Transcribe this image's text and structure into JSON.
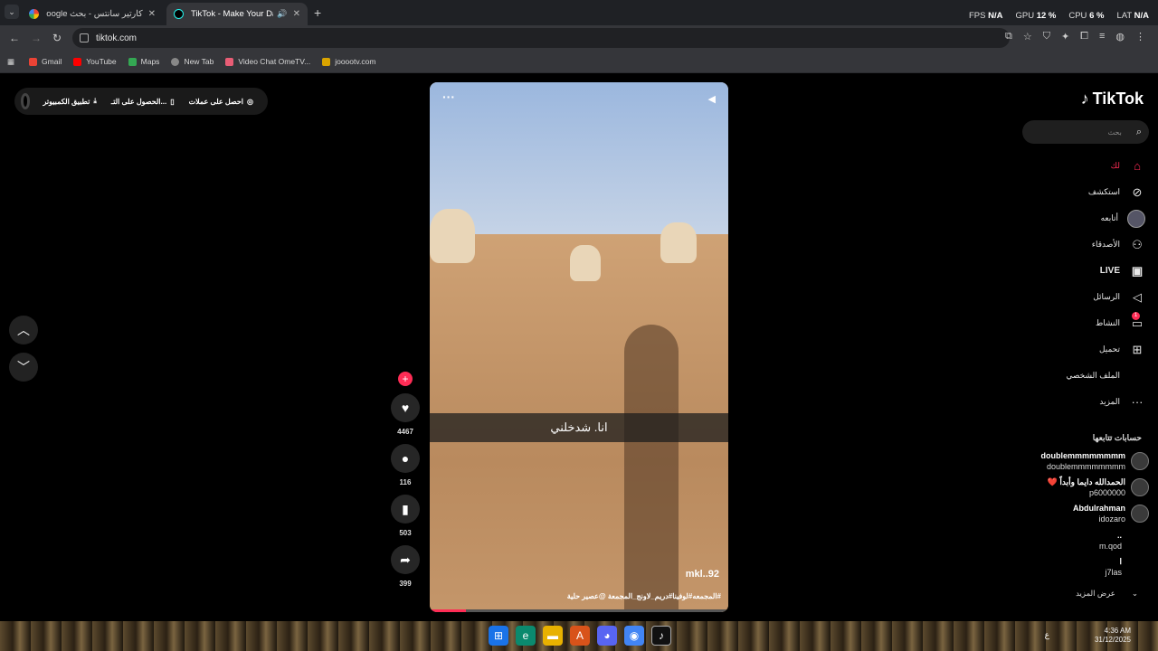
{
  "browser": {
    "tabs": [
      {
        "title": "كارتير سانتس - بحث Google",
        "active": false
      },
      {
        "title": "TikTok - Make Your Day",
        "active": true
      }
    ],
    "perf": {
      "fps_label": "FPS",
      "fps": "N/A",
      "gpu_label": "GPU",
      "gpu": "12 %",
      "cpu_label": "CPU",
      "cpu": "6 %",
      "lat_label": "LAT",
      "lat": "N/A"
    },
    "url": "tiktok.com",
    "bookmarks": [
      "Gmail",
      "YouTube",
      "Maps",
      "New Tab",
      "Video Chat OmeTV...",
      "jooootv.com"
    ]
  },
  "promo": {
    "item1": "احصل على عملات",
    "item2": "الحصول على التـ...",
    "item3": "تطبيق الكمبيوتر"
  },
  "video": {
    "caption": "انا. شدخلني",
    "author": "mkl..92",
    "description": "#المجمعه#لوفينا#دريم_لاونج_المجمعة @عصير حلية",
    "progress": 0.12
  },
  "actions": {
    "likes": "4467",
    "comments": "116",
    "saves": "503",
    "shares": "399"
  },
  "sidebar": {
    "logo": "TikTok",
    "search_placeholder": "بحث",
    "nav": [
      {
        "label": "لك",
        "icon": "home-icon"
      },
      {
        "label": "استكشف",
        "icon": "compass-icon"
      },
      {
        "label": "أتابعه",
        "icon": "avatar-icon"
      },
      {
        "label": "الأصدقاء",
        "icon": "friends-icon"
      },
      {
        "label": "LIVE",
        "icon": "live-icon"
      },
      {
        "label": "الرسائل",
        "icon": "send-icon"
      },
      {
        "label": "النشاط",
        "icon": "activity-icon"
      },
      {
        "label": "تحميل",
        "icon": "upload-icon"
      },
      {
        "label": "الملف الشخصي",
        "icon": "profile-icon"
      },
      {
        "label": "المزيد",
        "icon": "more-icon"
      }
    ],
    "activity_badge": "1",
    "following_title": "حسابات تتابعها",
    "accounts": [
      {
        "name": "doublemmmmmmmm",
        "handle": "doublemmmmmmmm"
      },
      {
        "name": "الحمدالله دايما وأبداً ❤️",
        "handle": "p6000000"
      },
      {
        "name": "Abdulrahman",
        "handle": "idozaro"
      },
      {
        "name": "..",
        "handle": "m.qod"
      },
      {
        "name": "ﺍ",
        "handle": "j7las"
      }
    ],
    "see_more": "عرض المزيد"
  },
  "taskbar": {
    "time": "4:36 AM",
    "date": "31/12/2025",
    "lang": "ع"
  }
}
